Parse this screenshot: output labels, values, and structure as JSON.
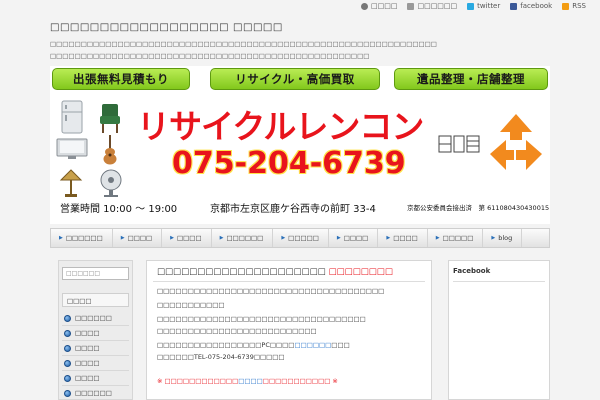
{
  "top_links": [
    {
      "label": "□□□□",
      "icon": "user-icon"
    },
    {
      "label": "□□□□□□",
      "icon": "list-icon"
    },
    {
      "label": "twitter",
      "icon": "twitter-icon"
    },
    {
      "label": "facebook",
      "icon": "facebook-icon"
    },
    {
      "label": "RSS",
      "icon": "rss-icon"
    }
  ],
  "site": {
    "title": "□□□□□□□□□□□□□□□□□□ □□□□□",
    "desc_line1": "□□□□□□□□□□□□□□□□□□□□□□□□□□□□□□□□□□□□□□□□□□□□□□□□□□□□□□□□□□□□□□□",
    "desc_line2": "□□□□□□□□□□□□□□□□□□□□□□□□□□□□□□□□□□□□□□□□□□□□□□□□□□□□"
  },
  "banner": {
    "pill1": "出張無料見積もり",
    "pill2": "リサイクル・高価買取",
    "pill3": "遺品整理・店舗整理",
    "brand": "リサイクルレンコン",
    "phone": "075-204-6739",
    "hours": "営業時間 10:00 ～ 19:00",
    "address": "京都市左京区鹿ケ谷西寺の前町 33-4",
    "license": "京都公安委員会接出済　第 611080430430015"
  },
  "nav": [
    "□□□□□□",
    "□□□□",
    "□□□□",
    "□□□□□□",
    "□□□□□",
    "□□□□",
    "□□□□",
    "□□□□□",
    "blog"
  ],
  "sidebar_left": {
    "search_placeholder": "□□□□□□",
    "heading": "□□□□",
    "items": [
      "□□□□□□",
      "□□□□",
      "□□□□",
      "□□□□",
      "□□□□",
      "□□□□□□"
    ]
  },
  "main": {
    "title": "□□□□□□□□□□□□□□□□□□□□□",
    "title_red": "□□□□□□□□",
    "line1": "□□□□□□□□□□□□□□□□□□□□□□□□□□□□□□□□□□□□□",
    "line2": "□□□□□□□□□□□",
    "line3": "□□□□□□□□□□□□□□□□□□□□□□□□□□□□□□□□□□",
    "line4": "□□□□□□□□□□□□□□□□□□□□□□□□□□",
    "line5_pre": "□□□□□□□□□□□□□□□□□PC□□□□",
    "line5_link": "□□□□□□",
    "line5_post": "□□□",
    "line6": "□□□□□□TEL-075-204-6739□□□□□",
    "notice_pre": "※ □□□□□□□□□□□□",
    "notice_link": "□□□□",
    "notice_post": "□□□□□□□□□□□ ※"
  },
  "sidebar_right": {
    "heading": "Facebook"
  },
  "colors": {
    "accent_red": "#e8141c",
    "button_green": "#9ad83a",
    "link_blue": "#1f6ec9"
  }
}
